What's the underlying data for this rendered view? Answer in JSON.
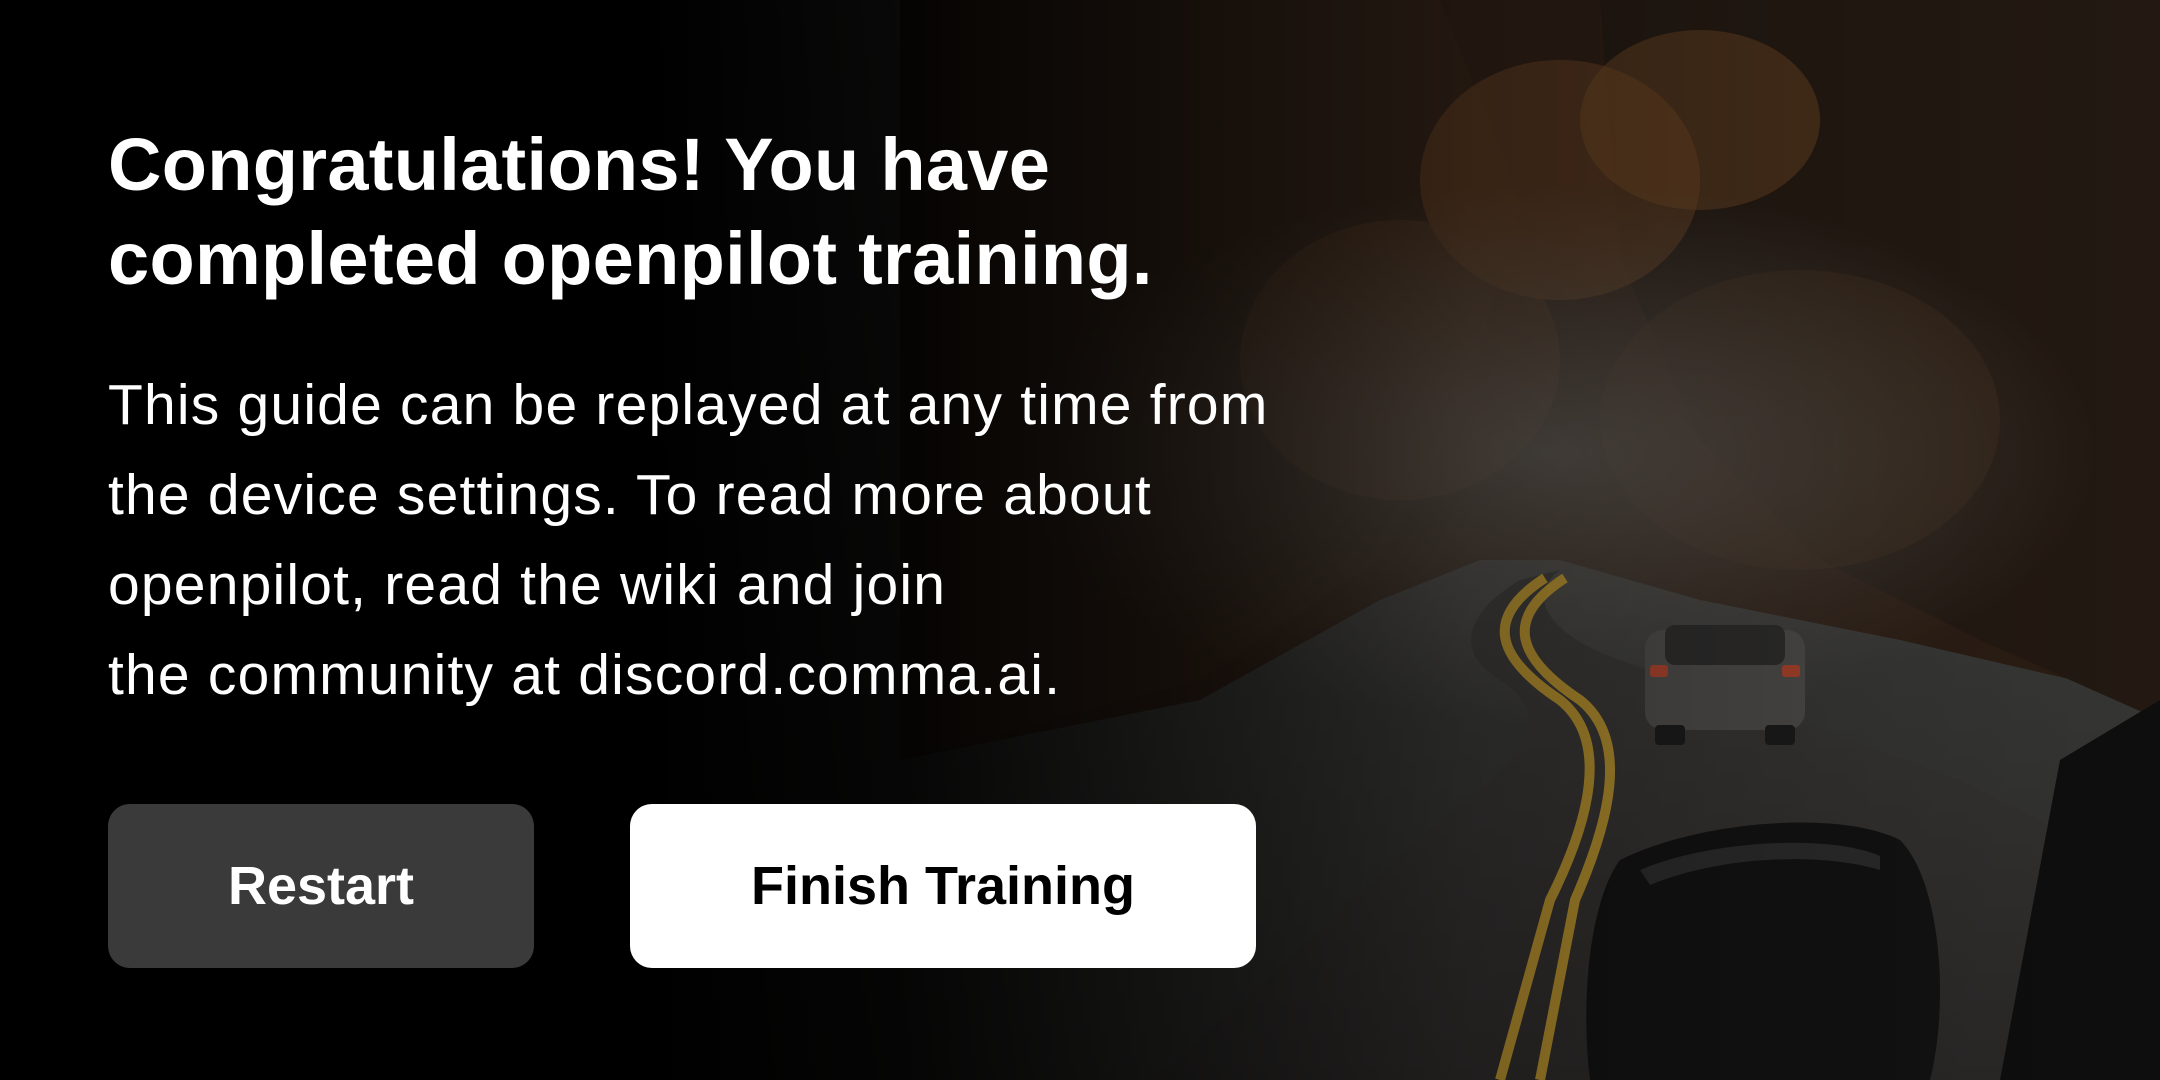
{
  "training": {
    "title_lines": [
      "Congratulations! You have",
      "completed openpilot training."
    ],
    "body_lines": [
      "This guide can be replayed at any time from",
      "the device settings. To read more about",
      "openpilot, read the wiki and join",
      "the community at discord.comma.ai."
    ],
    "restart_label": "Restart",
    "finish_label": "Finish Training"
  },
  "colors": {
    "background": "#000000",
    "restart_button": "#3a3a3a",
    "finish_button": "#ffffff"
  }
}
